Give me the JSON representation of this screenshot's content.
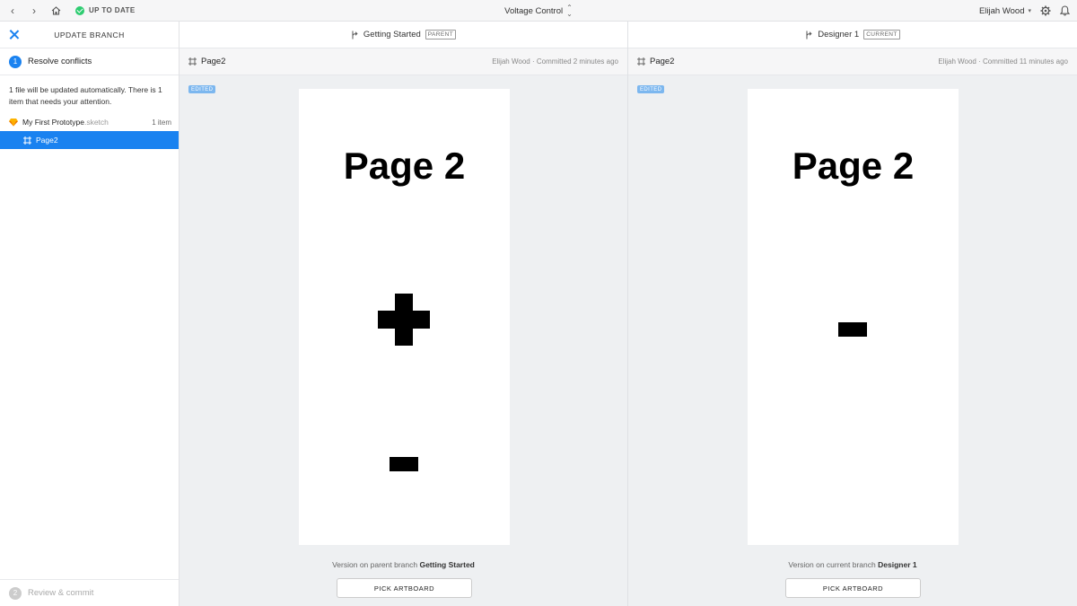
{
  "topbar": {
    "status": "UP TO DATE",
    "project_name": "Voltage Control",
    "user_name": "Elijah Wood"
  },
  "sidebar": {
    "title": "UPDATE BRANCH",
    "steps": [
      {
        "number": "1",
        "label": "Resolve conflicts"
      },
      {
        "number": "2",
        "label": "Review & commit"
      }
    ],
    "description": "1 file will be updated automatically. There is 1 item that needs your attention.",
    "file": {
      "name": "My First Prototype",
      "ext": ".sketch",
      "count": "1 item"
    },
    "page": "Page2"
  },
  "panels": {
    "left": {
      "branch": "Getting Started",
      "tag": "PARENT",
      "page": "Page2",
      "commit": "Elijah Wood · Committed 2 minutes ago",
      "badge": "EDITED",
      "artboard_title": "Page 2",
      "version_prefix": "Version on parent branch",
      "version_branch": "Getting Started",
      "button": "PICK ARTBOARD"
    },
    "right": {
      "branch": "Designer 1",
      "tag": "CURRENT",
      "page": "Page2",
      "commit": "Elijah Wood · Committed 11 minutes ago",
      "badge": "EDITED",
      "artboard_title": "Page 2",
      "version_prefix": "Version on current branch",
      "version_branch": "Designer 1",
      "button": "PICK ARTBOARD"
    }
  },
  "colors": {
    "accent": "#1a82f0",
    "status_ok": "#2ecc71",
    "badge": "#7cb7ef"
  }
}
